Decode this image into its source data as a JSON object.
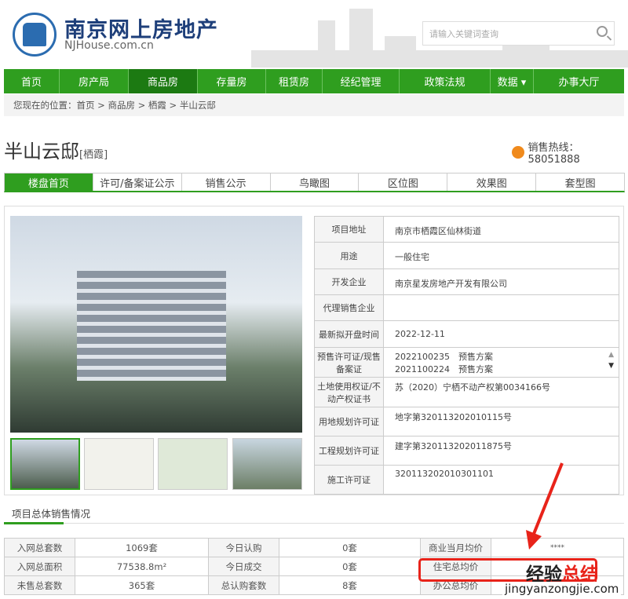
{
  "site": {
    "title": "南京网上房地产",
    "subtitle": "NJHouse.com.cn",
    "search_placeholder": "请输入关键词查询"
  },
  "nav": [
    "首页",
    "房产局",
    "商品房",
    "存量房",
    "租赁房",
    "经纪管理",
    "政策法规",
    "数据 ▾",
    "办事大厅"
  ],
  "breadcrumb": "您现在的位置：首页 > 商品房 > 栖霞 > 半山云邸",
  "project": {
    "name": "半山云邸",
    "district": "[栖霞]",
    "hotline": "销售热线：58051888"
  },
  "tabs": [
    "楼盘首页",
    "许可/备案证公示",
    "销售公示",
    "鸟瞰图",
    "区位图",
    "效果图",
    "套型图"
  ],
  "info": [
    {
      "label": "项目地址",
      "value": "南京市栖霞区仙林街道"
    },
    {
      "label": "用途",
      "value": "一般住宅"
    },
    {
      "label": "开发企业",
      "value": "南京星发房地产开发有限公司"
    },
    {
      "label": "代理销售企业",
      "value": ""
    },
    {
      "label": "最新拟开盘时间",
      "value": "2022-12-11"
    },
    {
      "label": "预售许可证/现售备案证",
      "value": "2022100235　预售方案",
      "value2": "2021100224　预售方案"
    },
    {
      "label": "土地使用权证/不动产权证书",
      "value": "苏（2020）宁栖不动产权第0034166号"
    },
    {
      "label": "用地规划许可证",
      "value": "地字第320113202010115号"
    },
    {
      "label": "工程规划许可证",
      "value": "建字第320113202011875号"
    },
    {
      "label": "施工许可证",
      "value": "320113202010301101"
    }
  ],
  "section_title": "项目总体销售情况",
  "sales": [
    [
      "入网总套数",
      "1069套",
      "今日认购",
      "0套",
      "商业当月均价",
      "****"
    ],
    [
      "入网总面积",
      "77538.8m²",
      "今日成交",
      "0套",
      "住宅总均价",
      ""
    ],
    [
      "未售总套数",
      "365套",
      "总认购套数",
      "8套",
      "办公总均价",
      ""
    ]
  ],
  "watermark": {
    "a": "经验",
    "b": "总结",
    "url": "jingyanzongjie.com"
  }
}
